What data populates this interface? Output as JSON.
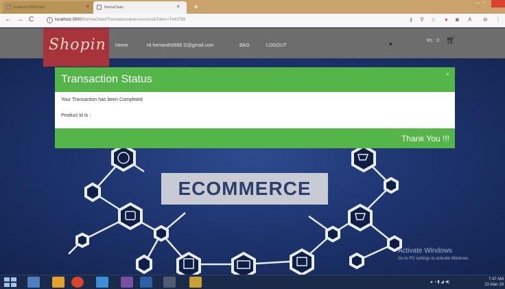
{
  "browser": {
    "tabs": [
      {
        "title": "localhost:3000/chain"
      },
      {
        "title": "NormaChain"
      }
    ],
    "new_tab_label": "+",
    "url_host": "localhost:3000",
    "url_path": "/NormaChain/Transtatusvalue=success&Token=Tk43769",
    "window": {
      "min": "–",
      "max": "▫"
    }
  },
  "site": {
    "logo": "Shopin",
    "nav": {
      "home": "Home",
      "greeting": "Hi hemanth9996 l2@gmail.com",
      "bag": "BAG",
      "logout": "LOGOUT"
    },
    "cart_total": "Rs : 0",
    "banner": "ECOMMERCE"
  },
  "modal": {
    "title": "Transaction Status",
    "close_label": "×",
    "message": "Your Transaction has been Completed",
    "product_label": "Product Id Is :",
    "footer_text": "Thank You !!!"
  },
  "watermark": {
    "title": "Activate Windows",
    "subtitle": "Go to PC settings to activate Windows."
  },
  "taskbar": {
    "time": "7:47 AM",
    "date": "22-Mar-19"
  },
  "colors": {
    "modal_green": "#54b548",
    "logo_red": "#a8343b",
    "navbar_gray": "#6d6d6d",
    "hero_blue": "#1e3570"
  }
}
